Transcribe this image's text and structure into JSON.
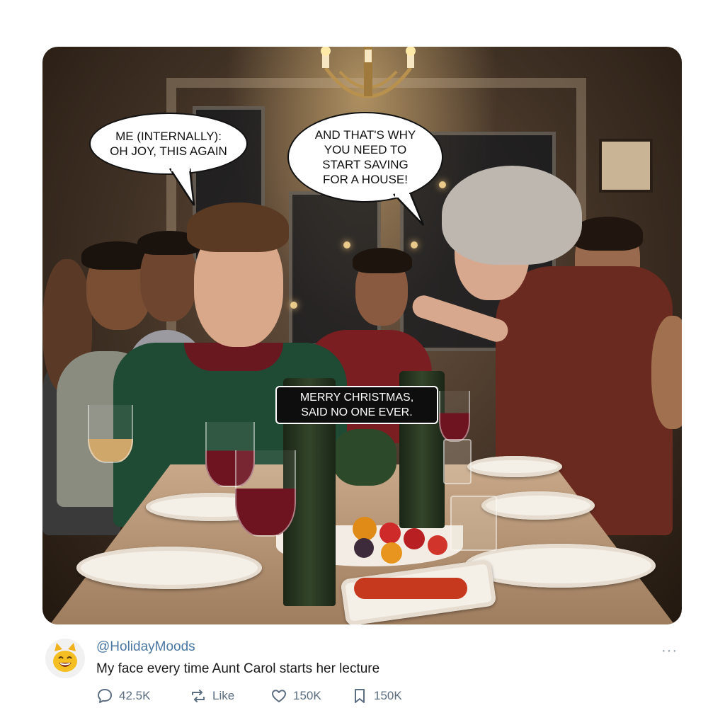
{
  "image": {
    "speech_bubble_left": "ME (INTERNALLY):\nOH JOY, THIS AGAIN",
    "speech_bubble_right": "AND THAT'S WHY\nYOU NEED TO\nSTART SAVING\nFOR A HOUSE!",
    "caption": "MERRY CHRISTMAS,\nSAID NO ONE EVER."
  },
  "post": {
    "avatar_icon": "laughing-cat-emoji",
    "handle": "@HolidayMoods",
    "text": "My face every time Aunt Carol starts her lecture",
    "more_icon": "more-dots-icon",
    "more_label": "···"
  },
  "actions": {
    "reply_count": "42.5K",
    "repost_label": "Like",
    "like_count": "150K",
    "bookmark_count": "150K"
  },
  "colors": {
    "handle": "#4a77a3",
    "action_icon": "#5c6e80"
  }
}
